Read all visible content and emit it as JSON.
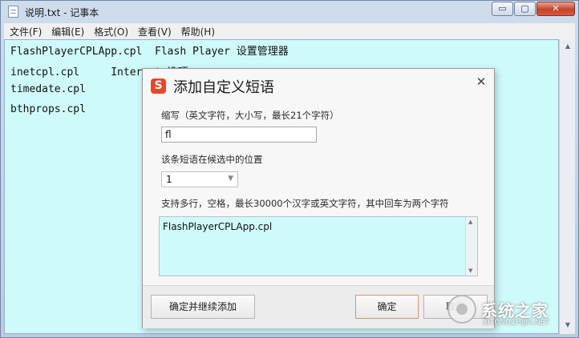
{
  "window": {
    "title": "说明.txt - 记事本",
    "min_label": "▭",
    "max_label": "▢",
    "close_label": "✕"
  },
  "menu": [
    {
      "label": "文件(F)"
    },
    {
      "label": "编辑(E)"
    },
    {
      "label": "格式(O)"
    },
    {
      "label": "查看(V)"
    },
    {
      "label": "帮助(H)"
    }
  ],
  "editor": {
    "lines": [
      "FlashPlayerCPLApp.cpl  Flash Player 设置管理器",
      "inetcpl.cpl     Internet 选项",
      "timedate.cpl",
      "bthprops.cpl"
    ],
    "background": "#cffafa"
  },
  "dialog": {
    "logo_letter": "S",
    "title": "添加自定义短语",
    "close_label": "✕",
    "abbr_label": "缩写（英文字符，大小写，最长21个字符）",
    "abbr_value": "fl",
    "position_label": "该条短语在候选中的位置",
    "position_value": "1",
    "content_label": "支持多行，空格，最长30000个汉字或英文字符，其中回车为两个字符",
    "content_value": "FlashPlayerCPLApp.cpl",
    "continue_button": "确定并继续添加",
    "ok_button": "确定",
    "cancel_button": "取消",
    "accent_color": "#e8472a"
  },
  "watermark": {
    "text": "系统之家",
    "url": "XITONGZHIJIA.NET"
  }
}
